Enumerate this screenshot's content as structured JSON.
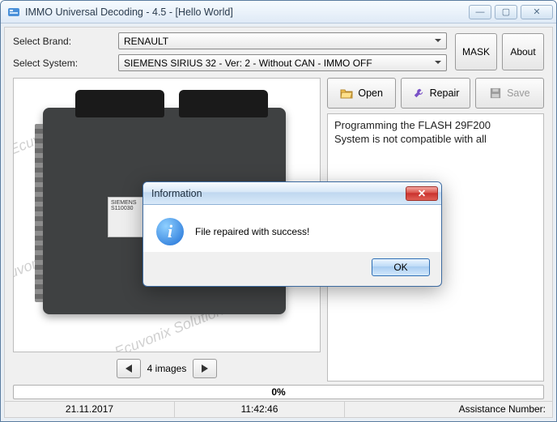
{
  "window": {
    "title": "IMMO Universal Decoding - 4.5 - [Hello World]",
    "controls": {
      "minimize": "—",
      "maximize": "▢",
      "close": "✕"
    }
  },
  "selectors": {
    "brand_label": "Select Brand:",
    "brand_value": "RENAULT",
    "system_label": "Select System:",
    "system_value": "SIEMENS SIRIUS 32 - Ver: 2 - Without CAN -  IMMO OFF"
  },
  "side_buttons": {
    "mask": "MASK",
    "about": "About"
  },
  "actions": {
    "open": "Open",
    "repair": "Repair",
    "save": "Save"
  },
  "log": {
    "line1": "Programming the FLASH 29F200",
    "line2": "System is not compatible with all"
  },
  "pager": {
    "label": "4 images"
  },
  "ecu_sticker": {
    "brand": "SIEMENS",
    "pn": "S110030"
  },
  "watermark": "Ecuvonix Solutions",
  "progress": {
    "text": "0%"
  },
  "statusbar": {
    "date": "21.11.2017",
    "time": "11:42:46",
    "assist": "Assistance Number:"
  },
  "dialog": {
    "title": "Information",
    "message": "File repaired with success!",
    "ok": "OK",
    "close_glyph": "✕"
  }
}
